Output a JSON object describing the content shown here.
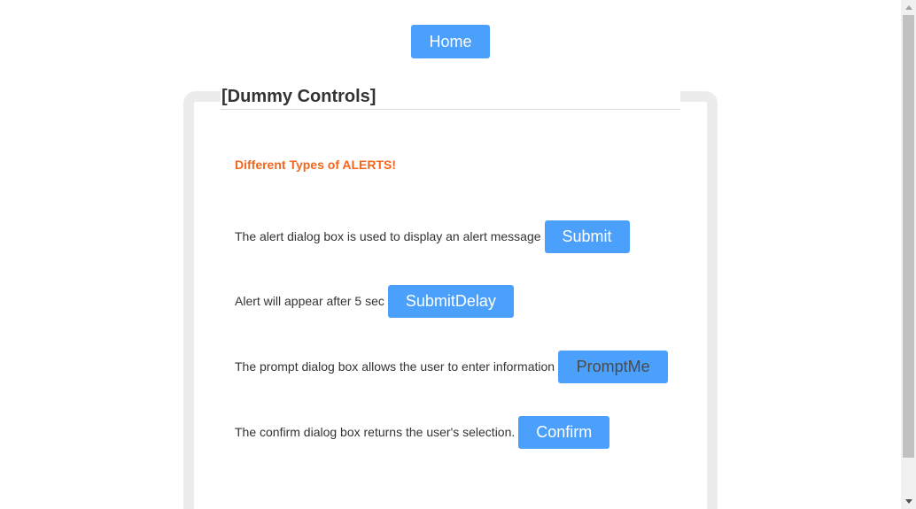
{
  "nav": {
    "home_label": "Home"
  },
  "panel": {
    "legend": "[Dummy Controls]",
    "heading": "Different Types of ALERTS!"
  },
  "rows": [
    {
      "text": "The alert dialog box is used to display an alert message",
      "button": "Submit"
    },
    {
      "text": "Alert will appear after 5 sec",
      "button": "SubmitDelay"
    },
    {
      "text": "The prompt dialog box allows the user to enter information",
      "button": "PromptMe"
    },
    {
      "text": "The confirm dialog box returns the user's selection.",
      "button": "Confirm"
    }
  ],
  "colors": {
    "button_bg": "#4aa0fb",
    "heading": "#f2671f",
    "panel_border": "#ececec"
  }
}
